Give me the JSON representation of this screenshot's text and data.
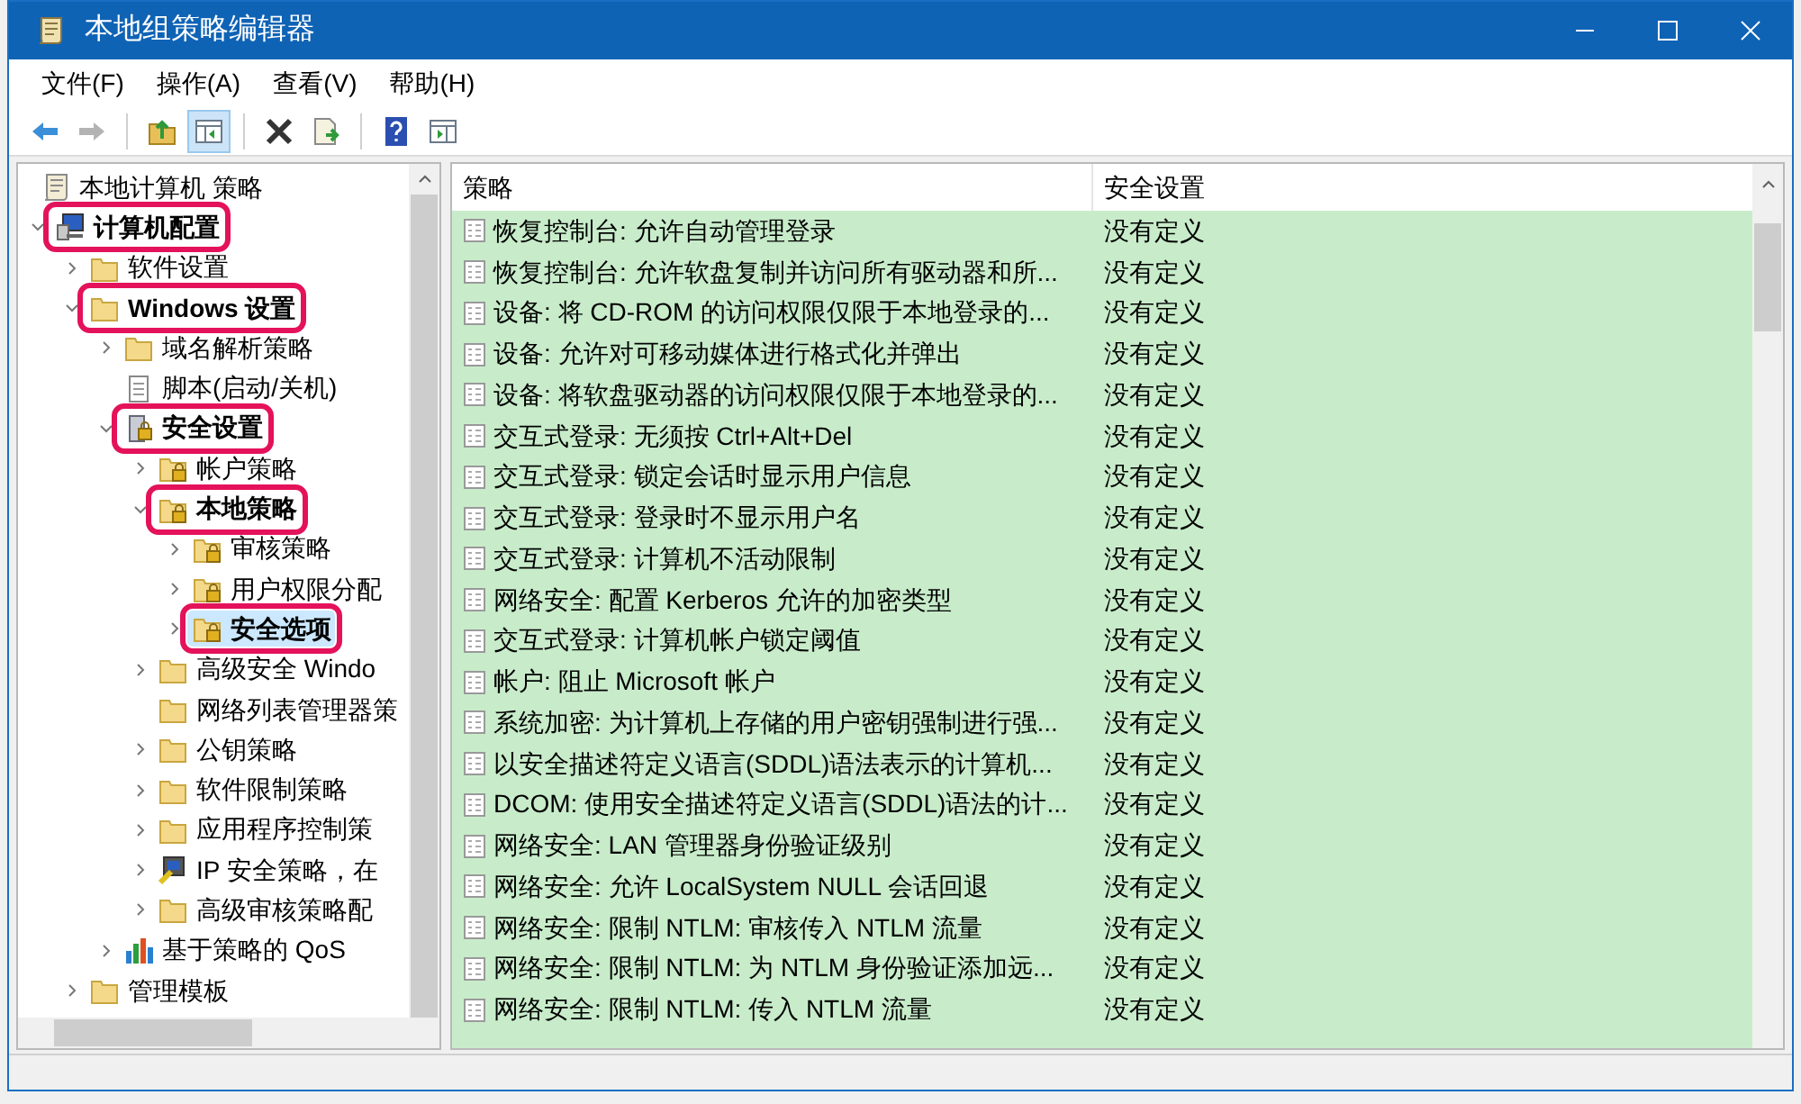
{
  "window": {
    "title": "本地组策略编辑器"
  },
  "menu": [
    "文件(F)",
    "操作(A)",
    "查看(V)",
    "帮助(H)"
  ],
  "toolbar": [
    {
      "kind": "back",
      "disabled": false,
      "pressed": false
    },
    {
      "kind": "forward",
      "disabled": true,
      "pressed": false
    },
    {
      "kind": "sep"
    },
    {
      "kind": "up",
      "disabled": false,
      "pressed": false
    },
    {
      "kind": "tree",
      "disabled": false,
      "pressed": true
    },
    {
      "kind": "sep"
    },
    {
      "kind": "delete",
      "disabled": false,
      "pressed": false
    },
    {
      "kind": "export",
      "disabled": false,
      "pressed": false
    },
    {
      "kind": "sep"
    },
    {
      "kind": "help",
      "disabled": false,
      "pressed": false
    },
    {
      "kind": "pane",
      "disabled": false,
      "pressed": false
    }
  ],
  "tree": [
    {
      "label": "本地计算机 策略",
      "kind": "scroll",
      "selected": false,
      "highlighted": false,
      "children": [
        {
          "label": "计算机配置",
          "kind": "computer",
          "expanded": true,
          "selected": false,
          "highlighted": true,
          "children": [
            {
              "label": "软件设置",
              "kind": "folder",
              "expanded": false,
              "selected": false,
              "highlighted": false
            },
            {
              "label": "Windows 设置",
              "kind": "folder",
              "expanded": true,
              "selected": false,
              "highlighted": true,
              "children": [
                {
                  "label": "域名解析策略",
                  "kind": "folder",
                  "expanded": false,
                  "selected": false,
                  "highlighted": false
                },
                {
                  "label": "脚本(启动/关机)",
                  "kind": "script",
                  "selected": false,
                  "highlighted": false
                },
                {
                  "label": "安全设置",
                  "kind": "security",
                  "expanded": true,
                  "selected": false,
                  "highlighted": true,
                  "children": [
                    {
                      "label": "帐户策略",
                      "kind": "lockfolder",
                      "expanded": false,
                      "selected": false,
                      "highlighted": false
                    },
                    {
                      "label": "本地策略",
                      "kind": "lockfolder",
                      "expanded": true,
                      "selected": false,
                      "highlighted": true,
                      "children": [
                        {
                          "label": "审核策略",
                          "kind": "lockfolder",
                          "expanded": false,
                          "selected": false,
                          "highlighted": false
                        },
                        {
                          "label": "用户权限分配",
                          "kind": "lockfolder",
                          "expanded": false,
                          "selected": false,
                          "highlighted": false
                        },
                        {
                          "label": "安全选项",
                          "kind": "lockfolder",
                          "expanded": false,
                          "selected": true,
                          "highlighted": true
                        }
                      ]
                    },
                    {
                      "label": "高级安全 Windo",
                      "kind": "folder",
                      "expanded": false,
                      "selected": false,
                      "highlighted": false
                    },
                    {
                      "label": "网络列表管理器策",
                      "kind": "folder",
                      "selected": false,
                      "highlighted": false
                    },
                    {
                      "label": "公钥策略",
                      "kind": "folder",
                      "expanded": false,
                      "selected": false,
                      "highlighted": false
                    },
                    {
                      "label": "软件限制策略",
                      "kind": "folder",
                      "expanded": false,
                      "selected": false,
                      "highlighted": false
                    },
                    {
                      "label": "应用程序控制策",
                      "kind": "folder",
                      "expanded": false,
                      "selected": false,
                      "highlighted": false
                    },
                    {
                      "label": "IP 安全策略，在",
                      "kind": "ipsec",
                      "expanded": false,
                      "selected": false,
                      "highlighted": false
                    },
                    {
                      "label": "高级审核策略配",
                      "kind": "folder",
                      "expanded": false,
                      "selected": false,
                      "highlighted": false
                    }
                  ]
                },
                {
                  "label": "基于策略的 QoS",
                  "kind": "chart",
                  "expanded": false,
                  "selected": false,
                  "highlighted": false
                }
              ]
            },
            {
              "label": "管理模板",
              "kind": "folder",
              "expanded": false,
              "selected": false,
              "highlighted": false
            }
          ]
        }
      ]
    }
  ],
  "list": {
    "columns": [
      "策略",
      "安全设置"
    ],
    "rows": [
      [
        "恢复控制台: 允许自动管理登录",
        "没有定义"
      ],
      [
        "恢复控制台: 允许软盘复制并访问所有驱动器和所...",
        "没有定义"
      ],
      [
        "设备: 将 CD-ROM 的访问权限仅限于本地登录的...",
        "没有定义"
      ],
      [
        "设备: 允许对可移动媒体进行格式化并弹出",
        "没有定义"
      ],
      [
        "设备: 将软盘驱动器的访问权限仅限于本地登录的...",
        "没有定义"
      ],
      [
        "交互式登录: 无须按 Ctrl+Alt+Del",
        "没有定义"
      ],
      [
        "交互式登录: 锁定会话时显示用户信息",
        "没有定义"
      ],
      [
        "交互式登录: 登录时不显示用户名",
        "没有定义"
      ],
      [
        "交互式登录: 计算机不活动限制",
        "没有定义"
      ],
      [
        "网络安全: 配置 Kerberos 允许的加密类型",
        "没有定义"
      ],
      [
        "交互式登录: 计算机帐户锁定阈值",
        "没有定义"
      ],
      [
        "帐户: 阻止 Microsoft 帐户",
        "没有定义"
      ],
      [
        "系统加密: 为计算机上存储的用户密钥强制进行强...",
        "没有定义"
      ],
      [
        "以安全描述符定义语言(SDDL)语法表示的计算机...",
        "没有定义"
      ],
      [
        "DCOM: 使用安全描述符定义语言(SDDL)语法的计...",
        "没有定义"
      ],
      [
        "网络安全: LAN 管理器身份验证级别",
        "没有定义"
      ],
      [
        "网络安全: 允许 LocalSystem NULL 会话回退",
        "没有定义"
      ],
      [
        "网络安全: 限制 NTLM: 审核传入 NTLM 流量",
        "没有定义"
      ],
      [
        "网络安全: 限制 NTLM: 为 NTLM 身份验证添加远...",
        "没有定义"
      ],
      [
        "网络安全: 限制 NTLM: 传入 NTLM 流量",
        "没有定义"
      ]
    ]
  }
}
